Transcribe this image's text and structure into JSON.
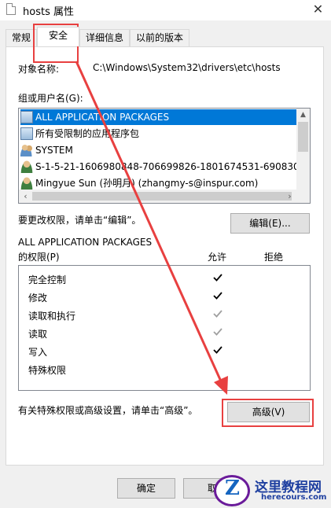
{
  "window": {
    "title": "hosts 属性"
  },
  "tabs": [
    {
      "label": "常规"
    },
    {
      "label": "安全"
    },
    {
      "label": "详细信息"
    },
    {
      "label": "以前的版本"
    }
  ],
  "object": {
    "label": "对象名称:",
    "value": "C:\\Windows\\System32\\drivers\\etc\\hosts"
  },
  "groups": {
    "label": "组或用户名(G):",
    "items": [
      {
        "name": "ALL APPLICATION PACKAGES",
        "icon": "package-icon",
        "selected": true
      },
      {
        "name": "所有受限制的应用程序包",
        "icon": "package-icon",
        "selected": false
      },
      {
        "name": "SYSTEM",
        "icon": "users-icon",
        "selected": false
      },
      {
        "name": "S-1-5-21-1606980848-706699826-1801674531-690830",
        "icon": "user-icon",
        "selected": false
      },
      {
        "name": "Mingyue Sun (孙明月) (zhangmy-s@inspur.com)",
        "icon": "user-icon",
        "selected": false
      }
    ]
  },
  "edit": {
    "hint": "要更改权限，请单击“编辑”。",
    "button": "编辑(E)..."
  },
  "permissions": {
    "subject": "ALL APPLICATION PACKAGES",
    "label": "的权限(P)",
    "allow_header": "允许",
    "deny_header": "拒绝",
    "rows": [
      {
        "name": "完全控制",
        "allow": "checked"
      },
      {
        "name": "修改",
        "allow": "checked"
      },
      {
        "name": "读取和执行",
        "allow": "inherited"
      },
      {
        "name": "读取",
        "allow": "inherited"
      },
      {
        "name": "写入",
        "allow": "checked"
      },
      {
        "name": "特殊权限",
        "allow": "none"
      }
    ]
  },
  "advanced": {
    "hint": "有关特殊权限或高级设置，请单击“高级”。",
    "button": "高级(V)"
  },
  "footer": {
    "ok": "确定",
    "cancel": "取"
  },
  "watermark": {
    "name": "这里教程网",
    "url": "herecours.com",
    "letter": "Z"
  },
  "colors": {
    "selection": "#0078d7",
    "annotation": "#e84040",
    "checked": "#000000",
    "inherited": "#a0a0a0"
  }
}
